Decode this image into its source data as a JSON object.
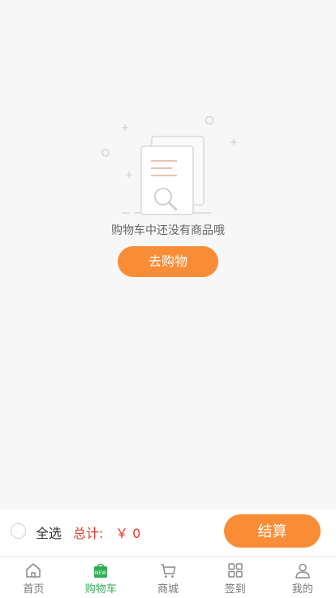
{
  "empty_state": {
    "message": "购物车中还没有商品哦",
    "button_label": "去购物"
  },
  "checkout": {
    "select_all_label": "全选",
    "total_label": "总计:",
    "total_value": "￥ 0",
    "settle_label": "结算"
  },
  "tabbar": {
    "items": [
      {
        "label": "首页",
        "icon": "home-icon",
        "active": false
      },
      {
        "label": "购物车",
        "icon": "cart-bag-new-icon",
        "badge": "NEW",
        "active": true
      },
      {
        "label": "商城",
        "icon": "shopping-cart-icon",
        "active": false
      },
      {
        "label": "签到",
        "icon": "grid-icon",
        "active": false
      },
      {
        "label": "我的",
        "icon": "user-icon",
        "active": false
      }
    ]
  },
  "colors": {
    "accent": "#f98c36",
    "price": "#e23a2e",
    "active_tab": "#2fae56",
    "background": "#f7f7f7"
  }
}
